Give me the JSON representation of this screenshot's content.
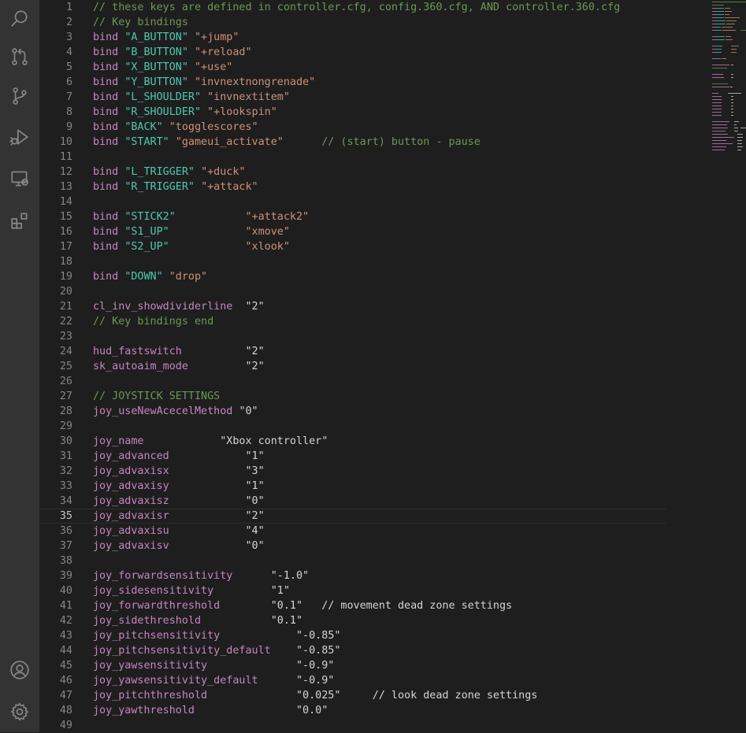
{
  "activity_bar": [
    {
      "name": "search-icon"
    },
    {
      "name": "source-control-icon"
    },
    {
      "name": "git-branch-icon"
    },
    {
      "name": "run-debug-icon"
    },
    {
      "name": "remote-explorer-icon"
    },
    {
      "name": "extensions-icon"
    }
  ],
  "activity_bar_bottom": [
    {
      "name": "account-icon"
    },
    {
      "name": "settings-gear-icon"
    }
  ],
  "colors": {
    "comment": "#6a9955",
    "keyword": "#c586c0",
    "string": "#ce9178",
    "key_string": "#4ec9b0",
    "plain": "#d4d4d4",
    "line_number": "#858585",
    "background": "#1e1e1e",
    "activity_bar": "#333333"
  },
  "editor": {
    "active_line": 35,
    "lines": [
      {
        "n": "1",
        "tokens": [
          {
            "t": "// these keys are defined in controller.cfg, config.360.cfg, AND controller.360.cfg",
            "c": "comment"
          }
        ]
      },
      {
        "n": "2",
        "tokens": [
          {
            "t": "// Key bindings",
            "c": "comment"
          }
        ]
      },
      {
        "n": "3",
        "tokens": [
          {
            "t": "bind ",
            "c": "kw"
          },
          {
            "t": "\"A_BUTTON\"",
            "c": "key"
          },
          {
            "t": " ",
            "c": "plain"
          },
          {
            "t": "\"+jump\"",
            "c": "str"
          }
        ]
      },
      {
        "n": "4",
        "tokens": [
          {
            "t": "bind ",
            "c": "kw"
          },
          {
            "t": "\"B_BUTTON\"",
            "c": "key"
          },
          {
            "t": " ",
            "c": "plain"
          },
          {
            "t": "\"+reload\"",
            "c": "str"
          }
        ]
      },
      {
        "n": "5",
        "tokens": [
          {
            "t": "bind ",
            "c": "kw"
          },
          {
            "t": "\"X_BUTTON\"",
            "c": "key"
          },
          {
            "t": " ",
            "c": "plain"
          },
          {
            "t": "\"+use\"",
            "c": "str"
          }
        ]
      },
      {
        "n": "6",
        "tokens": [
          {
            "t": "bind ",
            "c": "kw"
          },
          {
            "t": "\"Y_BUTTON\"",
            "c": "key"
          },
          {
            "t": " ",
            "c": "plain"
          },
          {
            "t": "\"invnextnongrenade\"",
            "c": "str"
          }
        ]
      },
      {
        "n": "7",
        "tokens": [
          {
            "t": "bind ",
            "c": "kw"
          },
          {
            "t": "\"L_SHOULDER\"",
            "c": "key"
          },
          {
            "t": " ",
            "c": "plain"
          },
          {
            "t": "\"invnextitem\"",
            "c": "str"
          }
        ]
      },
      {
        "n": "8",
        "tokens": [
          {
            "t": "bind ",
            "c": "kw"
          },
          {
            "t": "\"R_SHOULDER\"",
            "c": "key"
          },
          {
            "t": " ",
            "c": "plain"
          },
          {
            "t": "\"+lookspin\"",
            "c": "str"
          }
        ]
      },
      {
        "n": "9",
        "tokens": [
          {
            "t": "bind ",
            "c": "kw"
          },
          {
            "t": "\"BACK\"",
            "c": "key"
          },
          {
            "t": " ",
            "c": "plain"
          },
          {
            "t": "\"togglescores\"",
            "c": "str"
          }
        ]
      },
      {
        "n": "10",
        "tokens": [
          {
            "t": "bind ",
            "c": "kw"
          },
          {
            "t": "\"START\"",
            "c": "key"
          },
          {
            "t": " ",
            "c": "plain"
          },
          {
            "t": "\"gameui_activate\"",
            "c": "str"
          },
          {
            "t": "      // (start) button - pause",
            "c": "comment"
          }
        ]
      },
      {
        "n": "11",
        "tokens": []
      },
      {
        "n": "12",
        "tokens": [
          {
            "t": "bind ",
            "c": "kw"
          },
          {
            "t": "\"L_TRIGGER\"",
            "c": "key"
          },
          {
            "t": " ",
            "c": "plain"
          },
          {
            "t": "\"+duck\"",
            "c": "str"
          }
        ]
      },
      {
        "n": "13",
        "tokens": [
          {
            "t": "bind ",
            "c": "kw"
          },
          {
            "t": "\"R_TRIGGER\"",
            "c": "key"
          },
          {
            "t": " ",
            "c": "plain"
          },
          {
            "t": "\"+attack\"",
            "c": "str"
          }
        ]
      },
      {
        "n": "14",
        "tokens": []
      },
      {
        "n": "15",
        "tokens": [
          {
            "t": "bind ",
            "c": "kw"
          },
          {
            "t": "\"STICK2\"",
            "c": "key"
          },
          {
            "t": "           ",
            "c": "plain"
          },
          {
            "t": "\"+attack2\"",
            "c": "str"
          }
        ]
      },
      {
        "n": "16",
        "tokens": [
          {
            "t": "bind ",
            "c": "kw"
          },
          {
            "t": "\"S1_UP\"",
            "c": "key"
          },
          {
            "t": "            ",
            "c": "plain"
          },
          {
            "t": "\"xmove\"",
            "c": "str"
          }
        ]
      },
      {
        "n": "17",
        "tokens": [
          {
            "t": "bind ",
            "c": "kw"
          },
          {
            "t": "\"S2_UP\"",
            "c": "key"
          },
          {
            "t": "            ",
            "c": "plain"
          },
          {
            "t": "\"xlook\"",
            "c": "str"
          }
        ]
      },
      {
        "n": "18",
        "tokens": []
      },
      {
        "n": "19",
        "tokens": [
          {
            "t": "bind ",
            "c": "kw"
          },
          {
            "t": "\"DOWN\"",
            "c": "key"
          },
          {
            "t": " ",
            "c": "plain"
          },
          {
            "t": "\"drop\"",
            "c": "str"
          }
        ]
      },
      {
        "n": "20",
        "tokens": []
      },
      {
        "n": "21",
        "tokens": [
          {
            "t": "cl_inv_showdividerline",
            "c": "kw"
          },
          {
            "t": "  ",
            "c": "plain"
          },
          {
            "t": "\"2\"",
            "c": "plain"
          }
        ]
      },
      {
        "n": "22",
        "tokens": [
          {
            "t": "// Key bindings end",
            "c": "comment"
          }
        ]
      },
      {
        "n": "23",
        "tokens": []
      },
      {
        "n": "24",
        "tokens": [
          {
            "t": "hud_fastswitch",
            "c": "kw"
          },
          {
            "t": "          ",
            "c": "plain"
          },
          {
            "t": "\"2\"",
            "c": "plain"
          }
        ]
      },
      {
        "n": "25",
        "tokens": [
          {
            "t": "sk_autoaim_mode",
            "c": "kw"
          },
          {
            "t": "         ",
            "c": "plain"
          },
          {
            "t": "\"2\"",
            "c": "plain"
          }
        ]
      },
      {
        "n": "26",
        "tokens": []
      },
      {
        "n": "27",
        "tokens": [
          {
            "t": "// JOYSTICK SETTINGS",
            "c": "comment"
          }
        ]
      },
      {
        "n": "28",
        "tokens": [
          {
            "t": "joy_useNewAcecelMethod",
            "c": "kw"
          },
          {
            "t": " ",
            "c": "plain"
          },
          {
            "t": "\"0\"",
            "c": "plain"
          }
        ]
      },
      {
        "n": "29",
        "tokens": []
      },
      {
        "n": "30",
        "tokens": [
          {
            "t": "joy_name",
            "c": "kw"
          },
          {
            "t": "            ",
            "c": "plain"
          },
          {
            "t": "\"Xbox controller\"",
            "c": "plain"
          }
        ]
      },
      {
        "n": "31",
        "tokens": [
          {
            "t": "joy_advanced",
            "c": "kw"
          },
          {
            "t": "            ",
            "c": "plain"
          },
          {
            "t": "\"1\"",
            "c": "plain"
          }
        ]
      },
      {
        "n": "32",
        "tokens": [
          {
            "t": "joy_advaxisx",
            "c": "kw"
          },
          {
            "t": "            ",
            "c": "plain"
          },
          {
            "t": "\"3\"",
            "c": "plain"
          }
        ]
      },
      {
        "n": "33",
        "tokens": [
          {
            "t": "joy_advaxisy",
            "c": "kw"
          },
          {
            "t": "            ",
            "c": "plain"
          },
          {
            "t": "\"1\"",
            "c": "plain"
          }
        ]
      },
      {
        "n": "34",
        "tokens": [
          {
            "t": "joy_advaxisz",
            "c": "kw"
          },
          {
            "t": "            ",
            "c": "plain"
          },
          {
            "t": "\"0\"",
            "c": "plain"
          }
        ]
      },
      {
        "n": "35",
        "tokens": [
          {
            "t": "joy_advaxisr",
            "c": "kw"
          },
          {
            "t": "            ",
            "c": "plain"
          },
          {
            "t": "\"2\"",
            "c": "plain"
          }
        ]
      },
      {
        "n": "36",
        "tokens": [
          {
            "t": "joy_advaxisu",
            "c": "kw"
          },
          {
            "t": "            ",
            "c": "plain"
          },
          {
            "t": "\"4\"",
            "c": "plain"
          }
        ]
      },
      {
        "n": "37",
        "tokens": [
          {
            "t": "joy_advaxisv",
            "c": "kw"
          },
          {
            "t": "            ",
            "c": "plain"
          },
          {
            "t": "\"0\"",
            "c": "plain"
          }
        ]
      },
      {
        "n": "38",
        "tokens": []
      },
      {
        "n": "39",
        "tokens": [
          {
            "t": "joy_forwardsensitivity",
            "c": "kw"
          },
          {
            "t": "      ",
            "c": "plain"
          },
          {
            "t": "\"-1.0\"",
            "c": "plain"
          }
        ]
      },
      {
        "n": "40",
        "tokens": [
          {
            "t": "joy_sidesensitivity",
            "c": "kw"
          },
          {
            "t": "         ",
            "c": "plain"
          },
          {
            "t": "\"1\"",
            "c": "plain"
          }
        ]
      },
      {
        "n": "41",
        "tokens": [
          {
            "t": "joy_forwardthreshold",
            "c": "kw"
          },
          {
            "t": "        ",
            "c": "plain"
          },
          {
            "t": "\"0.1\"",
            "c": "plain"
          },
          {
            "t": "   // movement dead zone settings",
            "c": "plain"
          }
        ]
      },
      {
        "n": "42",
        "tokens": [
          {
            "t": "joy_sidethreshold",
            "c": "kw"
          },
          {
            "t": "           ",
            "c": "plain"
          },
          {
            "t": "\"0.1\"",
            "c": "plain"
          }
        ]
      },
      {
        "n": "43",
        "tokens": [
          {
            "t": "joy_pitchsensitivity",
            "c": "kw"
          },
          {
            "t": "            ",
            "c": "plain"
          },
          {
            "t": "\"-0.85\"",
            "c": "plain"
          }
        ]
      },
      {
        "n": "44",
        "tokens": [
          {
            "t": "joy_pitchsensitivity_default",
            "c": "kw"
          },
          {
            "t": "    ",
            "c": "plain"
          },
          {
            "t": "\"-0.85\"",
            "c": "plain"
          }
        ]
      },
      {
        "n": "45",
        "tokens": [
          {
            "t": "joy_yawsensitivity",
            "c": "kw"
          },
          {
            "t": "              ",
            "c": "plain"
          },
          {
            "t": "\"-0.9\"",
            "c": "plain"
          }
        ]
      },
      {
        "n": "46",
        "tokens": [
          {
            "t": "joy_yawsensitivity_default",
            "c": "kw"
          },
          {
            "t": "      ",
            "c": "plain"
          },
          {
            "t": "\"-0.9\"",
            "c": "plain"
          }
        ]
      },
      {
        "n": "47",
        "tokens": [
          {
            "t": "joy_pitchthreshold",
            "c": "kw"
          },
          {
            "t": "              ",
            "c": "plain"
          },
          {
            "t": "\"0.025\"",
            "c": "plain"
          },
          {
            "t": "     // look dead zone settings",
            "c": "plain"
          }
        ]
      },
      {
        "n": "48",
        "tokens": [
          {
            "t": "joy_yawthreshold",
            "c": "kw"
          },
          {
            "t": "                ",
            "c": "plain"
          },
          {
            "t": "\"0.0\"",
            "c": "plain"
          }
        ]
      },
      {
        "n": "49",
        "tokens": []
      }
    ]
  }
}
